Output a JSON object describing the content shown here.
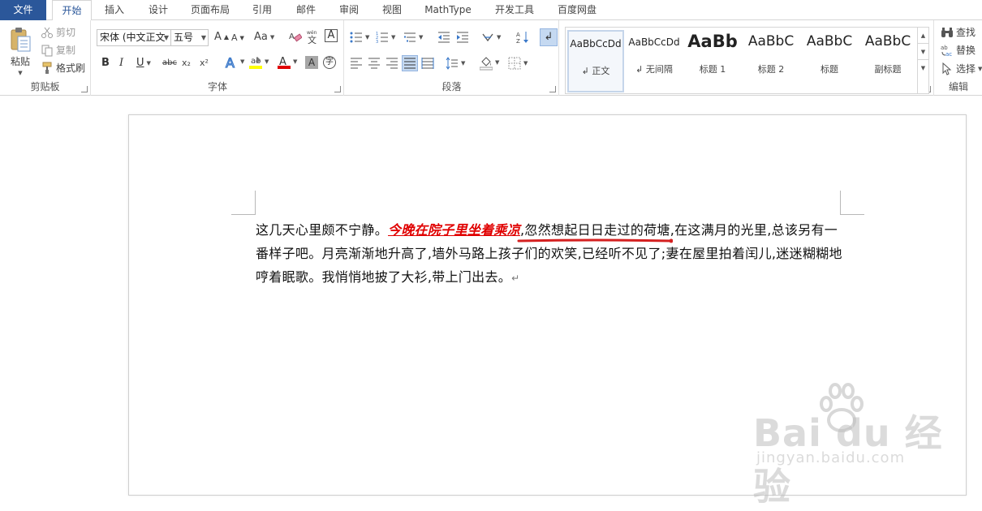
{
  "tabs": [
    {
      "label": "文件"
    },
    {
      "label": "开始"
    },
    {
      "label": "插入"
    },
    {
      "label": "设计"
    },
    {
      "label": "页面布局"
    },
    {
      "label": "引用"
    },
    {
      "label": "邮件"
    },
    {
      "label": "审阅"
    },
    {
      "label": "视图"
    },
    {
      "label": "MathType"
    },
    {
      "label": "开发工具"
    },
    {
      "label": "百度网盘"
    }
  ],
  "clipboard": {
    "paste_label": "粘贴",
    "cut_label": "剪切",
    "copy_label": "复制",
    "format_painter_label": "格式刷",
    "group_label": "剪贴板"
  },
  "font": {
    "font_name": "宋体 (中文正文",
    "font_size": "五号",
    "grow_label": "A",
    "shrink_label": "A",
    "case_label": "Aa",
    "bold": "B",
    "italic": "I",
    "underline": "U",
    "strike": "abc",
    "subscript": "x₂",
    "superscript": "x²",
    "group_label": "字体"
  },
  "paragraph": {
    "group_label": "段落"
  },
  "styles": {
    "items": [
      {
        "preview": "AaBbCcDd",
        "name": "↲ 正文"
      },
      {
        "preview": "AaBbCcDd",
        "name": "↲ 无间隔"
      },
      {
        "preview": "AaBb",
        "name": "标题 1"
      },
      {
        "preview": "AaBbC",
        "name": "标题 2"
      },
      {
        "preview": "AaBbC",
        "name": "标题"
      },
      {
        "preview": "AaBbC",
        "name": "副标题"
      }
    ],
    "group_label": "样式"
  },
  "editing": {
    "find_label": "查找",
    "replace_label": "替换",
    "select_label": "选择",
    "group_label": "编辑"
  },
  "document": {
    "text_before": "这几天心里颇不宁静。",
    "highlight": "今晚在院子里坐着乘凉",
    "text_after": ",忽然想起日日走过的荷塘,在这满月的光里,总该另有一番样子吧。月亮渐渐地升高了,墙外马路上孩子们的欢笑,已经听不见了;妻在屋里拍着闰儿,迷迷糊糊地哼着眠歌。我悄悄地披了大衫,带上门出去。",
    "paragraph_mark": "↵"
  },
  "watermark": {
    "main": "Bai du 经验",
    "sub": "jingyan.baidu.com"
  },
  "colors": {
    "file_tab": "#2b579a",
    "highlight_text": "#e00000",
    "font_color_bar": "#e00000",
    "highlight_color_bar": "#ffff00"
  }
}
